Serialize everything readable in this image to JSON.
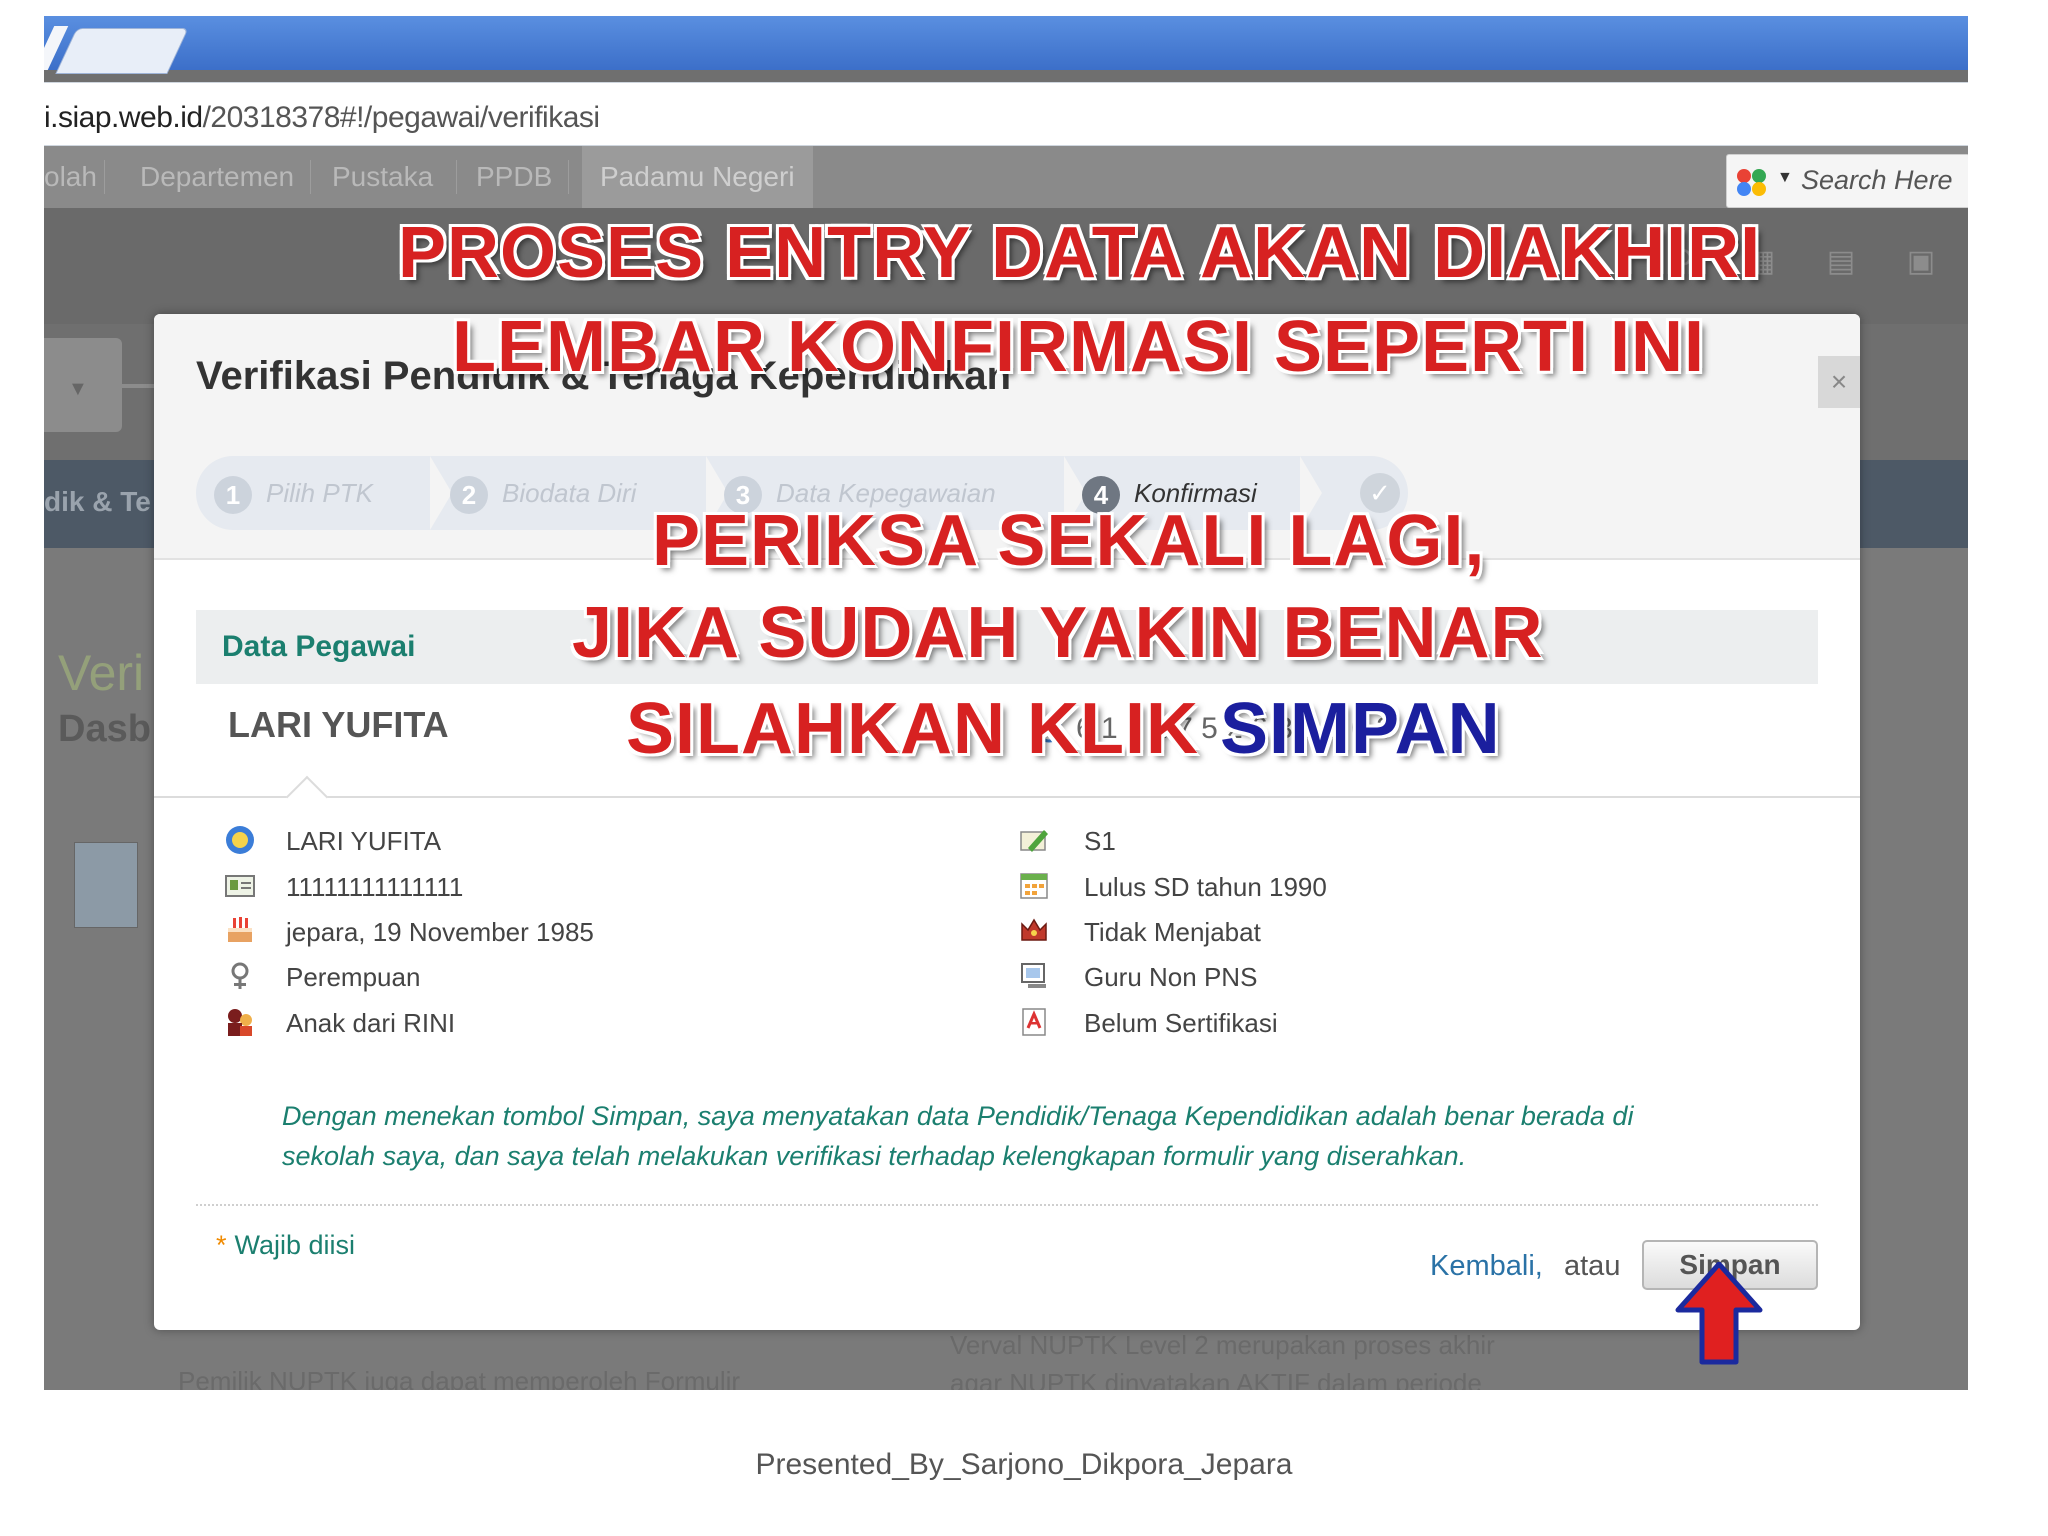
{
  "browser": {
    "url_host": "i.siap.web.id",
    "url_path": "/20318378#!/pegawai/verifikasi"
  },
  "site_nav": {
    "items": [
      "olah",
      "Departemen",
      "Pustaka",
      "PPDB",
      "Padamu Negeri"
    ],
    "search_placeholder": "Search Here"
  },
  "background": {
    "left_label": "dik & Te",
    "page_title": "Veri",
    "page_subtitle": "Dasb",
    "text_left": "Pemilik NUPTK juga dapat memperoleh Formulir",
    "text_right_1": "Verval NUPTK Level 2 merupakan proses akhir",
    "text_right_2": "agar NUPTK dinyatakan AKTIF dalam periode"
  },
  "modal": {
    "title": "Verifikasi Pendidik & Tenaga Kependidikan",
    "close": "×",
    "steps": [
      {
        "num": "1",
        "label": "Pilih PTK"
      },
      {
        "num": "2",
        "label": "Biodata Diri"
      },
      {
        "num": "3",
        "label": "Data Kepegawaian"
      },
      {
        "num": "4",
        "label": "Konfirmasi"
      }
    ],
    "section_label": "Data Pegawai",
    "person_name": "LARI YUFITA",
    "person_id": "6 1 5 2 7 5 2 6 3 3 1 0 3",
    "left_info": [
      "LARI YUFITA",
      "11111111111111",
      "jepara, 19 November 1985",
      "Perempuan",
      "Anak dari RINI"
    ],
    "right_info": [
      "S1",
      "Lulus SD tahun 1990",
      "Tidak Menjabat",
      "Guru Non PNS",
      "Belum Sertifikasi"
    ],
    "declaration": "Dengan menekan tombol Simpan, saya menyatakan data Pendidik/Tenaga Kependidikan adalah benar berada di sekolah saya, dan saya telah melakukan verifikasi terhadap kelengkapan formulir yang diserahkan.",
    "required_note": "Wajib diisi",
    "back_link": "Kembali,",
    "or_text": "atau",
    "save_button": "Simpan"
  },
  "annotations": {
    "line1": "PROSES ENTRY DATA  AKAN DIAKHIRI",
    "line2": "LEMBAR KONFIRMASI SEPERTI INI",
    "line3": "PERIKSA SEKALI LAGI,",
    "line4": "JIKA SUDAH YAKIN BENAR",
    "line5_red": "SILAHKAN KLIK ",
    "line5_blue": "SIMPAN"
  },
  "footer": "Presented_By_Sarjono_Dikpora_Jepara",
  "colors": {
    "annotation_red": "#d72121",
    "annotation_blue": "#1b1f9e",
    "teal_text": "#1b7f6f",
    "link_blue": "#2a72a6"
  }
}
